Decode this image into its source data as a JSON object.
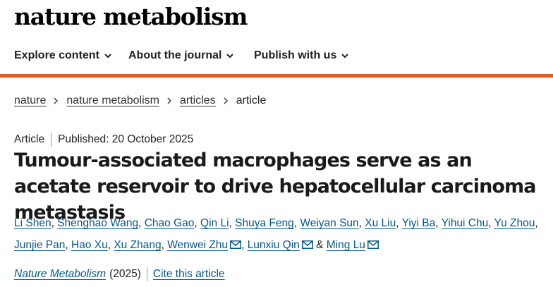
{
  "brand": {
    "logo_text": "nature metabolism"
  },
  "nav": {
    "items": [
      {
        "label": "Explore content"
      },
      {
        "label": "About the journal"
      },
      {
        "label": "Publish with us"
      }
    ]
  },
  "colors": {
    "accent": "#e0592a",
    "link": "#06578b"
  },
  "breadcrumb": {
    "items": [
      "nature",
      "nature metabolism",
      "articles"
    ],
    "current": "article"
  },
  "article": {
    "type": "Article",
    "published": "Published: 20 October 2025",
    "title": "Tumour-associated macrophages serve as an acetate reservoir to drive hepatocellular carcinoma metastasis",
    "authors": [
      "Li Shen",
      "Shenghao Wang",
      "Chao Gao",
      "Qin Li",
      "Shuya Feng",
      "Weiyan Sun",
      "Xu Liu",
      "Yiyi Ba",
      "Yihui Chu",
      "Yu Zhou",
      "Junjie Pan",
      "Hao Xu",
      "Xu Zhang",
      "Wenwei Zhu",
      "Lunxiu Qin",
      "Ming Lu"
    ],
    "author_separator": ",",
    "author_conjunction": "&",
    "contact_icon": "envelope-icon",
    "journal": "Nature Metabolism",
    "year": "(2025)",
    "cite_label": "Cite this article"
  }
}
